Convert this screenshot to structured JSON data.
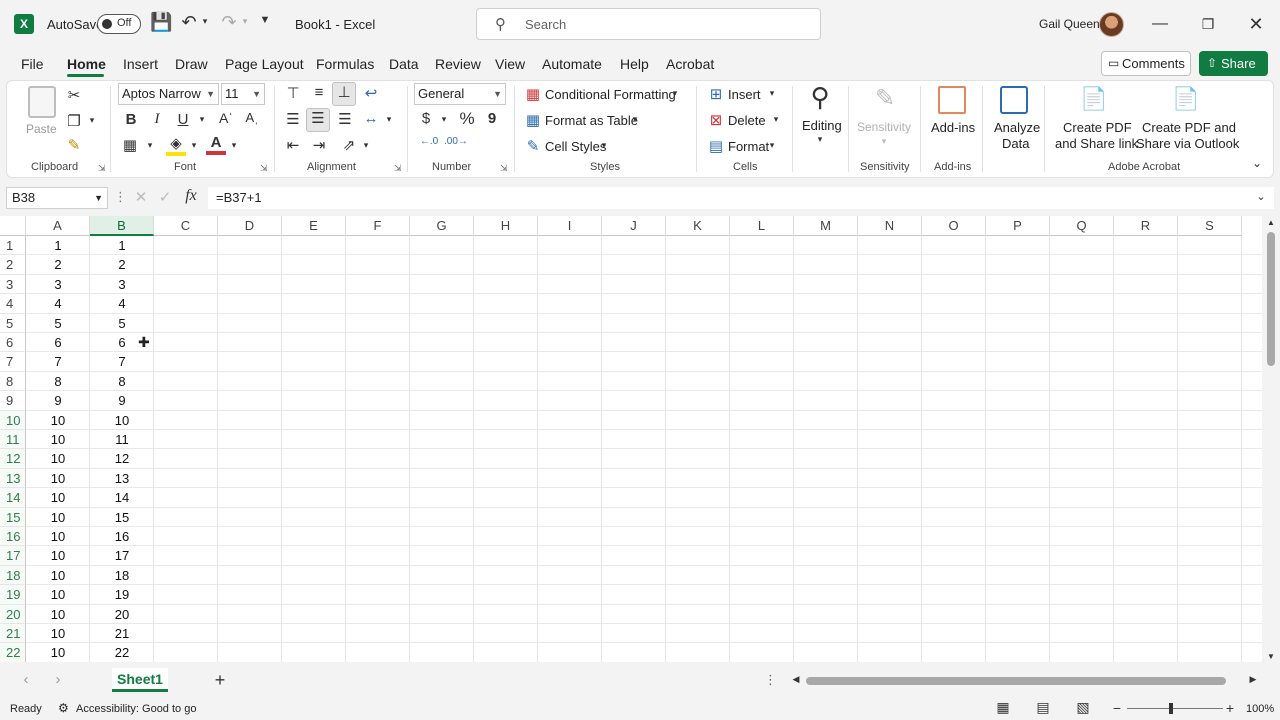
{
  "titlebar": {
    "autosave_label": "AutoSave",
    "autosave_state": "Off",
    "title": "Book1  -  Excel",
    "search_placeholder": "Search",
    "user_name": "Gail Queen"
  },
  "menu": {
    "tabs": [
      "File",
      "Home",
      "Insert",
      "Draw",
      "Page Layout",
      "Formulas",
      "Data",
      "Review",
      "View",
      "Automate",
      "Help",
      "Acrobat"
    ],
    "active": "Home",
    "comments_label": "Comments",
    "share_label": "Share"
  },
  "ribbon": {
    "clipboard": {
      "paste": "Paste",
      "group": "Clipboard"
    },
    "font": {
      "name": "Aptos Narrow",
      "size": "11",
      "bold": "B",
      "italic": "I",
      "underline": "U",
      "group": "Font"
    },
    "alignment": {
      "group": "Alignment"
    },
    "number": {
      "format": "General",
      "currency": "$",
      "percent": "%",
      "comma": "9",
      "group": "Number"
    },
    "styles": {
      "conditional": "Conditional Formatting",
      "format_table": "Format as Table",
      "cell_styles": "Cell Styles",
      "group": "Styles"
    },
    "cells": {
      "insert": "Insert",
      "delete": "Delete",
      "format": "Format",
      "group": "Cells"
    },
    "editing": {
      "label": "Editing"
    },
    "sensitivity": {
      "label": "Sensitivity",
      "group": "Sensitivity"
    },
    "addins": {
      "label": "Add-ins",
      "group": "Add-ins"
    },
    "analyze": {
      "line1": "Analyze",
      "line2": "Data"
    },
    "acrobat": {
      "pdf_link_1": "Create PDF",
      "pdf_link_2": "and Share link",
      "pdf_outlook_1": "Create PDF and",
      "pdf_outlook_2": "Share via Outlook",
      "group": "Adobe Acrobat"
    }
  },
  "formula_bar": {
    "cell_ref": "B38",
    "fx": "fx",
    "formula": "=B37+1"
  },
  "sheet": {
    "columns": [
      "A",
      "B",
      "C",
      "D",
      "E",
      "F",
      "G",
      "H",
      "I",
      "J",
      "K",
      "L",
      "M",
      "N",
      "O",
      "P",
      "Q",
      "R",
      "S"
    ],
    "selected_column": "B",
    "rows": [
      {
        "n": "1",
        "a": "1",
        "b": "1"
      },
      {
        "n": "2",
        "a": "2",
        "b": "2"
      },
      {
        "n": "3",
        "a": "3",
        "b": "3"
      },
      {
        "n": "4",
        "a": "4",
        "b": "4"
      },
      {
        "n": "5",
        "a": "5",
        "b": "5"
      },
      {
        "n": "6",
        "a": "6",
        "b": "6"
      },
      {
        "n": "7",
        "a": "7",
        "b": "7"
      },
      {
        "n": "8",
        "a": "8",
        "b": "8"
      },
      {
        "n": "9",
        "a": "9",
        "b": "9"
      },
      {
        "n": "10",
        "a": "10",
        "b": "10"
      },
      {
        "n": "11",
        "a": "10",
        "b": "11"
      },
      {
        "n": "12",
        "a": "10",
        "b": "12"
      },
      {
        "n": "13",
        "a": "10",
        "b": "13"
      },
      {
        "n": "14",
        "a": "10",
        "b": "14"
      },
      {
        "n": "15",
        "a": "10",
        "b": "15"
      },
      {
        "n": "16",
        "a": "10",
        "b": "16"
      },
      {
        "n": "17",
        "a": "10",
        "b": "17"
      },
      {
        "n": "18",
        "a": "10",
        "b": "18"
      },
      {
        "n": "19",
        "a": "10",
        "b": "19"
      },
      {
        "n": "20",
        "a": "10",
        "b": "20"
      },
      {
        "n": "21",
        "a": "10",
        "b": "21"
      },
      {
        "n": "22",
        "a": "10",
        "b": "22"
      }
    ],
    "highlighted_rows_from": "10",
    "tab": "Sheet1",
    "add_sheet": "+"
  },
  "status": {
    "ready": "Ready",
    "accessibility": "Accessibility: Good to go",
    "zoom": "100%"
  },
  "colors": {
    "accent": "#107c41",
    "share_bg": "#107c41"
  }
}
